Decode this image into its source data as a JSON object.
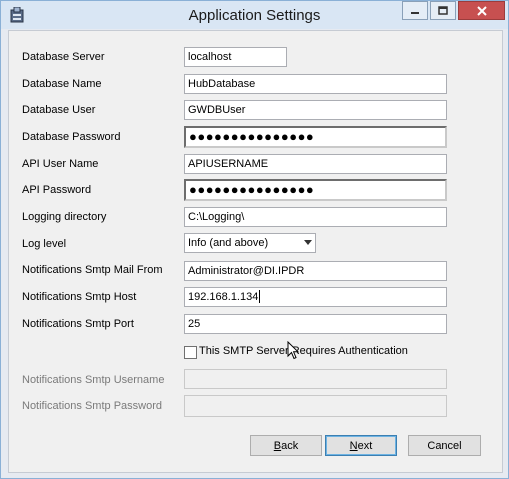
{
  "window": {
    "title": "Application Settings"
  },
  "fields": [
    {
      "label": "Database Server",
      "value": "localhost"
    },
    {
      "label": "Database Name",
      "value": "HubDatabase"
    },
    {
      "label": "Database User",
      "value": "GWDBUser"
    },
    {
      "label": "Database Password",
      "value": "●●●●●●●●●●●●●●●"
    },
    {
      "label": "API User Name",
      "value": "APIUSERNAME"
    },
    {
      "label": "API Password",
      "value": "●●●●●●●●●●●●●●●"
    },
    {
      "label": "Logging directory",
      "value": "C:\\Logging\\"
    },
    {
      "label": "Log level",
      "value": "Info (and above)"
    },
    {
      "label": "Notifications Smtp Mail From",
      "value": "Administrator@DI.IPDR"
    },
    {
      "label": "Notifications Smtp Host",
      "value": "192.168.1.134"
    },
    {
      "label": "Notifications Smtp Port",
      "value": "25"
    }
  ],
  "auth_checkbox": {
    "label": "This SMTP Server Requires Authentication",
    "checked": false
  },
  "auth_fields": [
    {
      "label": "Notifications Smtp Username",
      "value": ""
    },
    {
      "label": "Notifications Smtp Password",
      "value": ""
    }
  ],
  "buttons": {
    "back_mnemonic": "B",
    "back_rest": "ack",
    "next_mnemonic": "N",
    "next_rest": "ext",
    "cancel": "Cancel"
  },
  "colors": {
    "close_button": "#c75050",
    "titlebar": "#d9e6f4"
  }
}
